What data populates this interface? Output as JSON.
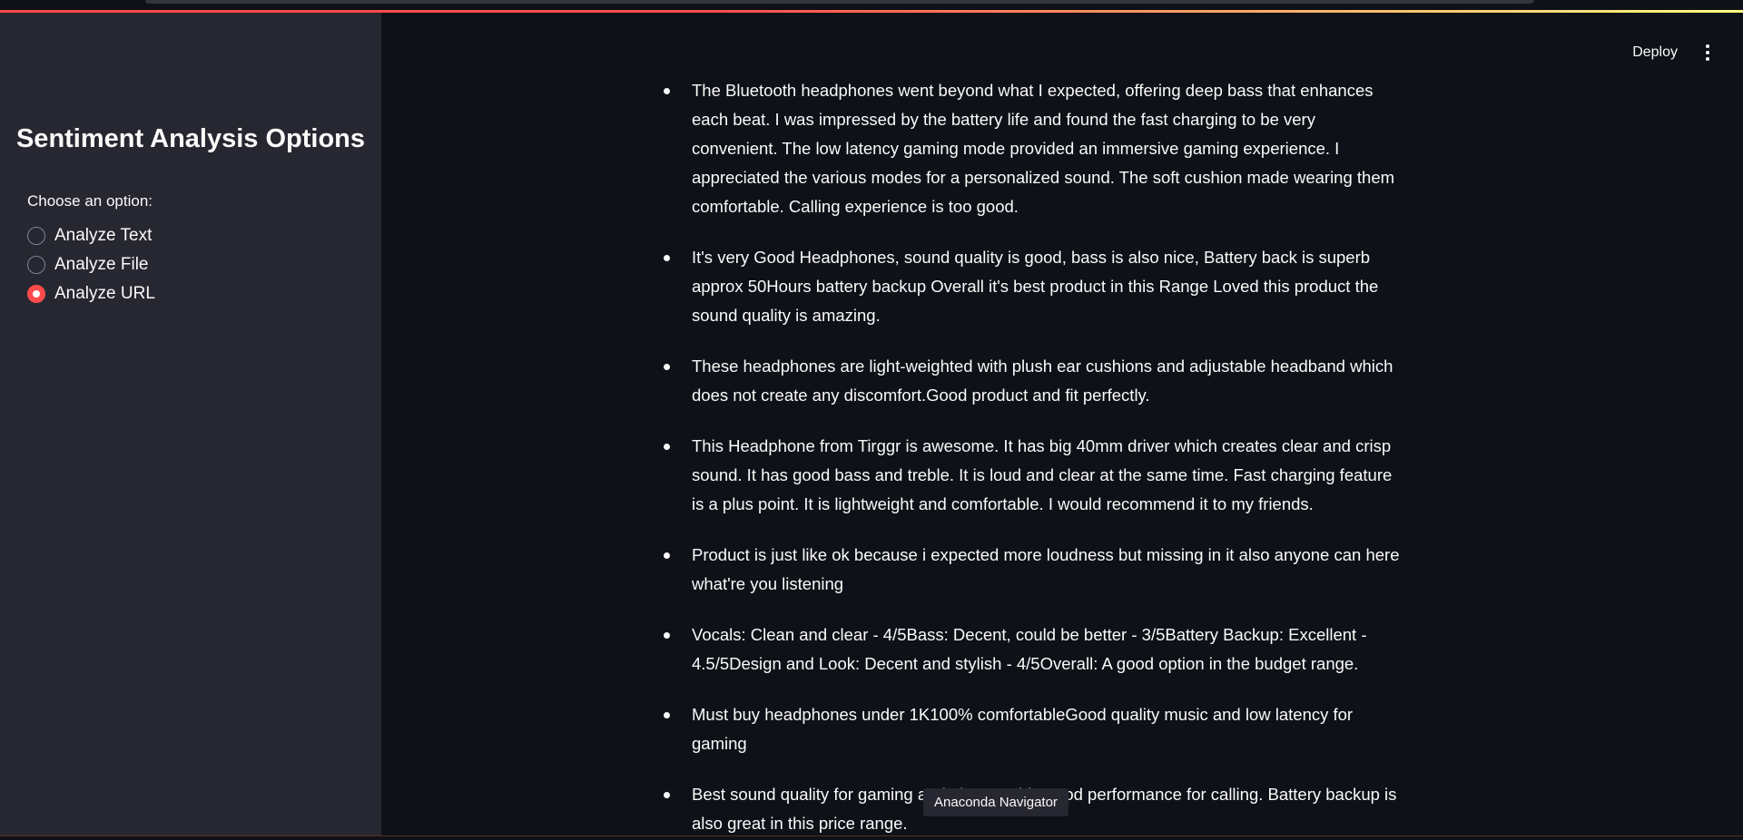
{
  "header": {
    "deploy_label": "Deploy",
    "menu_icon": "vertical-ellipsis-icon"
  },
  "sidebar": {
    "title": "Sentiment Analysis Options",
    "radio_label": "Choose an option:",
    "options": [
      {
        "label": "Analyze Text",
        "checked": false
      },
      {
        "label": "Analyze File",
        "checked": false
      },
      {
        "label": "Analyze URL",
        "checked": true
      }
    ]
  },
  "reviews": [
    "The Bluetooth headphones went beyond what I expected, offering deep bass that enhances each beat. I was impressed by the battery life and found the fast charging to be very convenient. The low latency gaming mode provided an immersive gaming experience. I appreciated the various modes for a personalized sound. The soft cushion made wearing them comfortable. Calling experience is too good.",
    "It's very Good Headphones, sound quality is good, bass is also nice, Battery back is superb approx 50Hours battery backup Overall it's best product in this Range Loved this product the sound quality is amazing.",
    "These headphones are light-weighted with plush ear cushions and adjustable headband which does not create any discomfort.Good product and fit perfectly.",
    "This Headphone from Tirggr is awesome. It has big 40mm driver which creates clear and crisp sound. It has good bass and treble. It is loud and clear at the same time. Fast charging feature is a plus point. It is lightweight and comfortable. I would recommend it to my friends.",
    "Product is just like ok because i expected more loudness but missing in it also anyone can here what're you listening",
    "Vocals: Clean and clear - 4/5Bass: Decent, could be better - 3/5Battery Backup: Excellent - 4.5/5Design and Look: Decent and stylish - 4/5Overall: A good option in the budget range.",
    "Must buy headphones under 1K100% comfortableGood quality music and low latency for gaming",
    "Best sound quality for gaming and also provide good performance for calling. Battery backup is also great in this price range."
  ],
  "tooltip": "Anaconda Navigator",
  "colors": {
    "accent": "#ff4b4b",
    "sidebar_bg": "#262730",
    "main_bg": "#0e1117",
    "text": "#fafafa"
  }
}
